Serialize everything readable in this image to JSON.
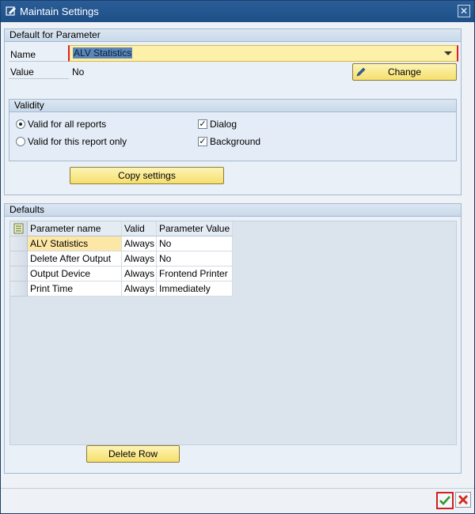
{
  "window": {
    "title": "Maintain Settings"
  },
  "default_param": {
    "header": "Default for Parameter",
    "name_label": "Name",
    "name_value": "ALV Statistics",
    "value_label": "Value",
    "value_value": "No",
    "change_button": "Change"
  },
  "validity": {
    "header": "Validity",
    "radio_all": "Valid for all reports",
    "radio_this": "Valid for this report only",
    "radio_selected": "all",
    "check_dialog": "Dialog",
    "check_background": "Background",
    "dialog_checked": true,
    "background_checked": true
  },
  "copy_button": "Copy settings",
  "defaults": {
    "header": "Defaults",
    "columns": [
      "Parameter name",
      "Valid",
      "Parameter Value"
    ],
    "rows": [
      {
        "name": "ALV Statistics",
        "valid": "Always",
        "value": "No"
      },
      {
        "name": "Delete After Output",
        "valid": "Always",
        "value": "No"
      },
      {
        "name": "Output Device",
        "valid": "Always",
        "value": "Frontend Printer"
      },
      {
        "name": "Print Time",
        "valid": "Always",
        "value": "Immediately"
      }
    ],
    "delete_button": "Delete Row"
  },
  "colors": {
    "accent": "#1e4f87",
    "button": "#f6df6c",
    "highlight": "#fde7a6"
  },
  "icons": {
    "title": "settings-window-icon",
    "close": "close-icon",
    "change": "pencil-icon",
    "ok": "checkmark-icon",
    "cancel": "cancel-x-icon",
    "table_config": "table-layout-icon"
  }
}
